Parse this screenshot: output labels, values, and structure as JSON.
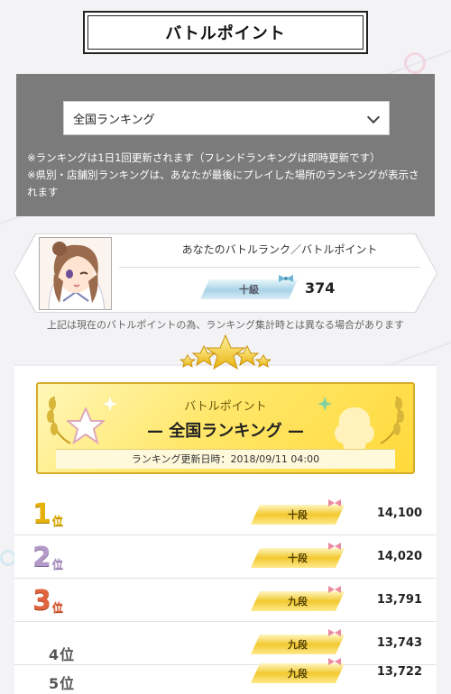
{
  "page": {
    "title": "バトルポイント"
  },
  "filter": {
    "selected": "全国ランキング",
    "notes": [
      "※ランキングは1日1回更新されます（フレンドランキングは即時更新です）",
      "※県別・店舗別ランキングは、あなたが最後にプレイした場所のランキングが表示されます"
    ]
  },
  "my_rank": {
    "title": "あなたのバトルランク／バトルポイント",
    "rank_label": "十級",
    "points": "374",
    "disclaimer": "上記は現在のバトルポイントの為、ランキング集計時とは異なる場合があります"
  },
  "ranking": {
    "subtitle": "バトルポイント",
    "title": "— 全国ランキング —",
    "updated": "ランキング更新日時：2018/09/11 04:00",
    "rows": [
      {
        "position": "1",
        "suffix": "位",
        "rank": "十段",
        "score": "14,100"
      },
      {
        "position": "2",
        "suffix": "位",
        "rank": "十段",
        "score": "14,020"
      },
      {
        "position": "3",
        "suffix": "位",
        "rank": "九段",
        "score": "13,791"
      },
      {
        "position": "4",
        "suffix": "位",
        "rank": "九段",
        "score": "13,743"
      },
      {
        "position": "5",
        "suffix": "位",
        "rank": "九段",
        "score": "13,722"
      }
    ]
  },
  "colors": {
    "panel": "#7b7b7b",
    "gold": "#e5b20b",
    "silver": "#b39ac8",
    "bronze": "#e0643e",
    "rank_badge_blue": "#a8d3e6"
  },
  "icons": {
    "dropdown": "chevron-down-icon",
    "stars": "stars-icon",
    "avatar": "player-avatar",
    "ribbon": "ribbon-icon",
    "laurel": "laurel-icon"
  }
}
